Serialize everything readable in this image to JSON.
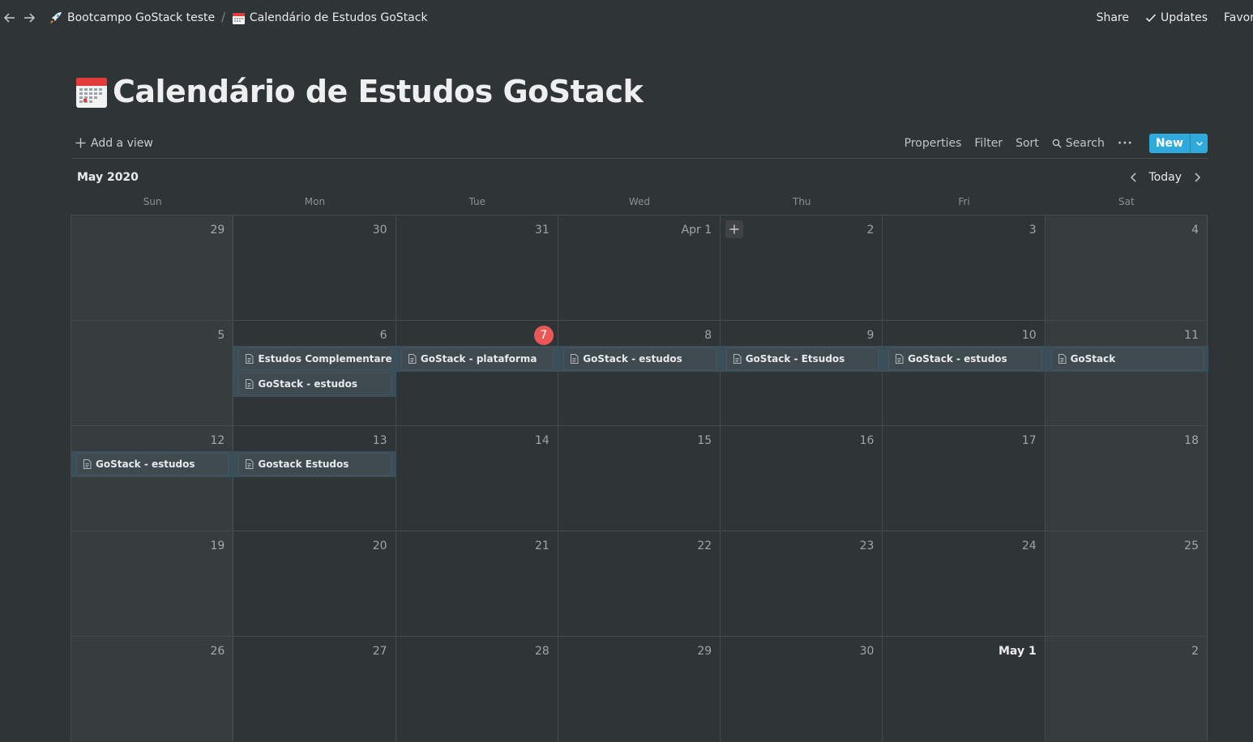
{
  "topbar": {
    "breadcrumb": [
      {
        "label": "Bootcampo GoStack teste",
        "icon": "rocket-icon"
      },
      {
        "label": "Calendário de Estudos GoStack",
        "icon": "calendar-icon"
      }
    ],
    "share_label": "Share",
    "updates_label": "Updates",
    "favorite_label": "Favorite"
  },
  "page": {
    "title": "Calendário de Estudos GoStack",
    "icon": "calendar-icon"
  },
  "view_bar": {
    "add_view_label": "Add a view",
    "properties_label": "Properties",
    "filter_label": "Filter",
    "sort_label": "Sort",
    "search_label": "Search",
    "more_label": "···",
    "new_label": "New"
  },
  "calendar": {
    "month_label": "May 2020",
    "today_label": "Today",
    "weekdays": [
      "Sun",
      "Mon",
      "Tue",
      "Wed",
      "Thu",
      "Fri",
      "Sat"
    ],
    "weeks": [
      [
        "29",
        "30",
        "31",
        "Apr 1",
        "2",
        "3",
        "4"
      ],
      [
        "5",
        "6",
        "7",
        "8",
        "9",
        "10",
        "11"
      ],
      [
        "12",
        "13",
        "14",
        "15",
        "16",
        "17",
        "18"
      ],
      [
        "19",
        "20",
        "21",
        "22",
        "23",
        "24",
        "25"
      ],
      [
        "26",
        "27",
        "28",
        "29",
        "30",
        "May 1",
        "2"
      ]
    ],
    "today": "7",
    "events": [
      {
        "title": "Estudos Complementares",
        "week": 1,
        "day": 1,
        "slot": 0
      },
      {
        "title": "GoStack - estudos",
        "week": 1,
        "day": 1,
        "slot": 1
      },
      {
        "title": "GoStack - plataforma",
        "week": 1,
        "day": 2,
        "slot": 0
      },
      {
        "title": "GoStack - estudos",
        "week": 1,
        "day": 3,
        "slot": 0
      },
      {
        "title": "GoStack - Etsudos",
        "week": 1,
        "day": 4,
        "slot": 0
      },
      {
        "title": "GoStack - estudos",
        "week": 1,
        "day": 5,
        "slot": 0
      },
      {
        "title": "GoStack",
        "week": 1,
        "day": 6,
        "slot": 0
      },
      {
        "title": "GoStack - estudos",
        "week": 2,
        "day": 0,
        "slot": 0
      },
      {
        "title": "Gostack Estudos",
        "week": 2,
        "day": 1,
        "slot": 0
      }
    ]
  },
  "colors": {
    "background": "#2f3437",
    "accent": "#2eaadc",
    "today_badge": "#eb5757",
    "event_card": "#3f4a50"
  }
}
